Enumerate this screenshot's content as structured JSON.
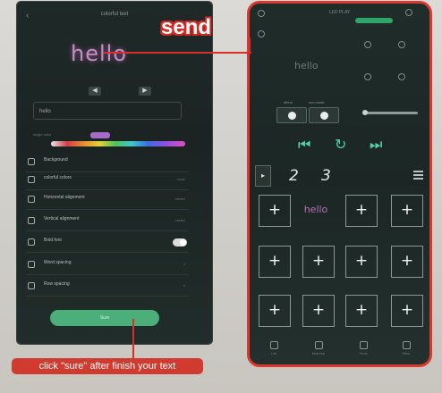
{
  "left_phone": {
    "back": "‹",
    "title": "colorful text",
    "preview_text": "hello",
    "input_value": "hello",
    "color_label": "single color",
    "swatch_color": "#a46cc8",
    "options": [
      {
        "label": "Background",
        "value": ""
      },
      {
        "label": "colorful colors",
        "value": "none"
      },
      {
        "label": "Horizontal alignment",
        "value": "center"
      },
      {
        "label": "Vertical alignment",
        "value": "center"
      },
      {
        "label": "Bold font",
        "value": ""
      },
      {
        "label": "Word spacing",
        "value": "0"
      },
      {
        "label": "Row spacing",
        "value": "0"
      }
    ],
    "sure_label": "Sure"
  },
  "right_phone": {
    "title": "LED PLAY",
    "preview_text": "hello",
    "switch_labels": [
      "effect",
      "eco mode"
    ],
    "tabs": [
      "2",
      "3"
    ],
    "grid": [
      "+",
      "hello",
      "+",
      "+",
      "+",
      "+",
      "+",
      "+",
      "+",
      "+",
      "+",
      "+"
    ],
    "nav": [
      "List",
      "Material",
      "Tools",
      "Mine"
    ]
  },
  "annotations": {
    "send": "send",
    "click_sure": "click \"sure\" after finish your text"
  },
  "colors": {
    "accent_red": "#d63027",
    "accent_green": "#4caf7a",
    "text_pink": "#c98ac9"
  }
}
